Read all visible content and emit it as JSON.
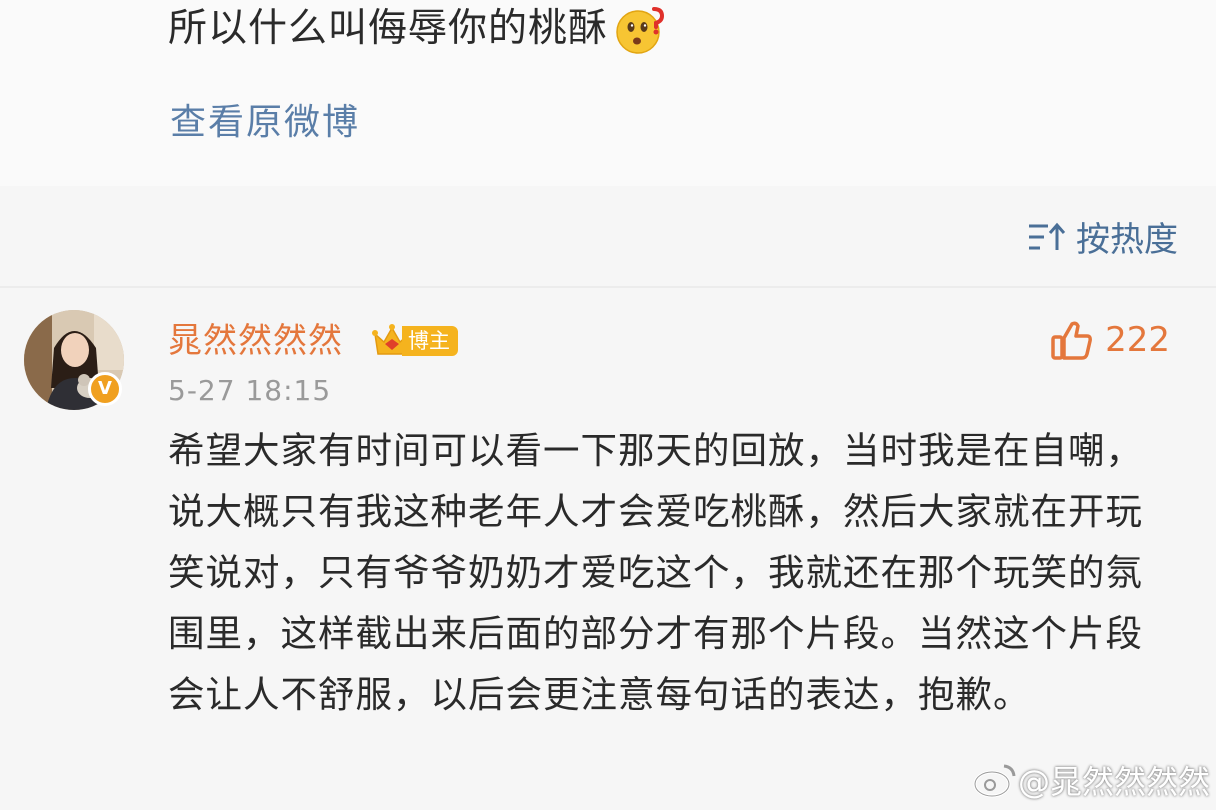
{
  "post": {
    "text": "所以什么叫侮辱你的桃酥",
    "emoji_icon": "surprised-question-face-icon",
    "view_original_label": "查看原微博"
  },
  "sort": {
    "label": "按热度",
    "icon": "sort-icon"
  },
  "comment": {
    "username": "晁然然然然",
    "host_badge": "博主",
    "verified_badge": "V",
    "like_count": "222",
    "timestamp": "5-27 18:15",
    "text": "希望大家有时间可以看一下那天的回放，当时我是在自嘲，说大概只有我这种老年人才会爱吃桃酥，然后大家就在开玩笑说对，只有爷爷奶奶才爱吃这个，我就还在那个玩笑的氛围里，这样截出来后面的部分才有那个片段。当然这个片段会让人不舒服，以后会更注意每句话的表达，抱歉。"
  },
  "watermark": {
    "text": "@晁然然然然",
    "icon": "weibo-logo-icon"
  },
  "colors": {
    "link": "#5a7ea8",
    "username": "#e4773c",
    "badge": "#f5b31e",
    "background": "#f6f6f6"
  }
}
